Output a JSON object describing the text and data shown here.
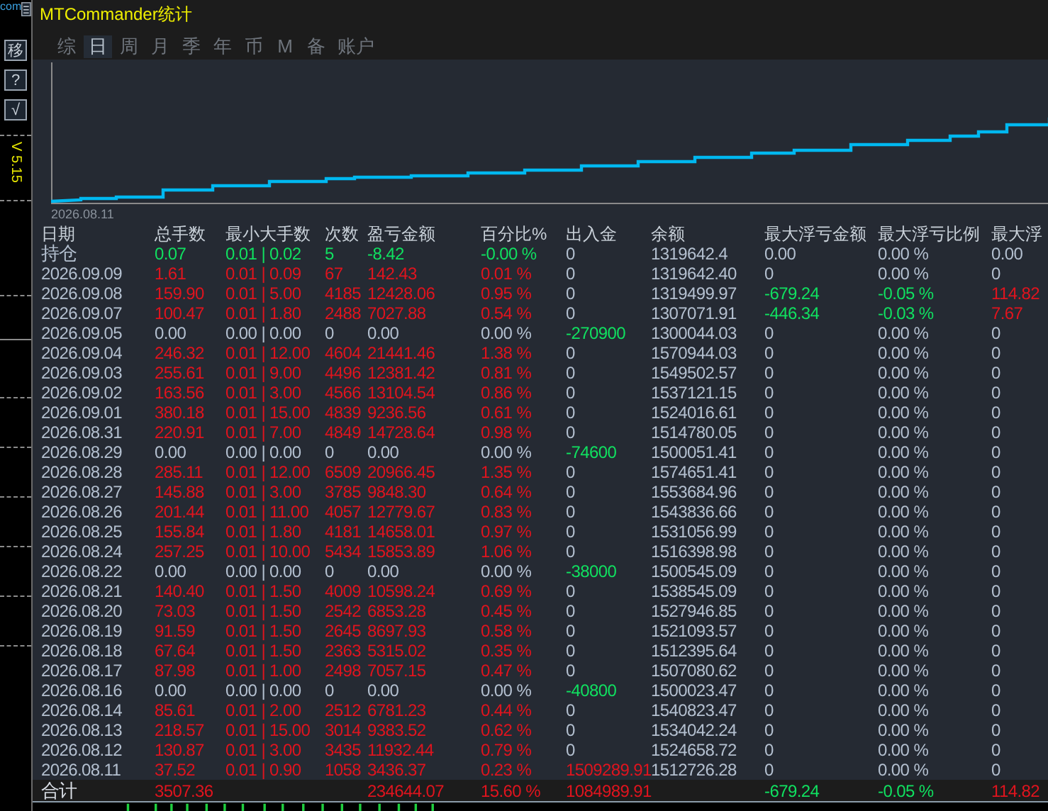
{
  "side_toolbar": {
    "site_text": "com",
    "buttons": [
      "移",
      "?",
      "√"
    ],
    "version": "V 5.15"
  },
  "window": {
    "title": "MTCommander统计"
  },
  "tabs": [
    {
      "label": "综",
      "selected": false
    },
    {
      "label": "日",
      "selected": true
    },
    {
      "label": "周",
      "selected": false
    },
    {
      "label": "月",
      "selected": false
    },
    {
      "label": "季",
      "selected": false
    },
    {
      "label": "年",
      "selected": false
    },
    {
      "label": "币",
      "selected": false
    },
    {
      "label": "M",
      "selected": false
    },
    {
      "label": "备",
      "selected": false
    },
    {
      "label": "账户",
      "selected": false
    }
  ],
  "chart": {
    "start_label": "2026.08.11"
  },
  "table": {
    "columns": [
      "日期",
      "总手数",
      "最小大手数",
      "次数",
      "盈亏金额",
      "百分比%",
      "出入金",
      "余额",
      "最大浮亏金额",
      "最大浮亏比例",
      "最大浮"
    ],
    "rows": [
      [
        {
          "text": "持仓",
          "color": "#b4c0d0"
        },
        {
          "text": "0.07",
          "color": "#10e060"
        },
        {
          "text": "0.01 | 0.02",
          "color": "#10e060"
        },
        {
          "text": "5",
          "color": "#10e060"
        },
        {
          "text": "-8.42",
          "color": "#10e060"
        },
        {
          "text": "-0.00 %",
          "color": "#10e060"
        },
        {
          "text": "0",
          "color": "#b4c0d0"
        },
        {
          "text": "1319642.4",
          "color": "#b4c0d0"
        },
        {
          "text": "0.00",
          "color": "#b4c0d0"
        },
        {
          "text": "0.00 %",
          "color": "#b4c0d0"
        },
        {
          "text": "0.00",
          "color": "#b4c0d0"
        }
      ],
      [
        {
          "text": "2026.09.09",
          "color": "#b4c0d0"
        },
        {
          "text": "1.61",
          "color": "#e0141e"
        },
        {
          "text": "0.01 | 0.09",
          "color": "#e0141e"
        },
        {
          "text": "67",
          "color": "#e0141e"
        },
        {
          "text": "142.43",
          "color": "#e0141e"
        },
        {
          "text": "0.01 %",
          "color": "#e0141e"
        },
        {
          "text": "0",
          "color": "#b4c0d0"
        },
        {
          "text": "1319642.40",
          "color": "#b4c0d0"
        },
        {
          "text": "0",
          "color": "#b4c0d0"
        },
        {
          "text": "0.00 %",
          "color": "#b4c0d0"
        },
        {
          "text": "0",
          "color": "#b4c0d0"
        }
      ],
      [
        {
          "text": "2026.09.08",
          "color": "#b4c0d0"
        },
        {
          "text": "159.90",
          "color": "#e0141e"
        },
        {
          "text": "0.01 | 5.00",
          "color": "#e0141e"
        },
        {
          "text": "4185",
          "color": "#e0141e"
        },
        {
          "text": "12428.06",
          "color": "#e0141e"
        },
        {
          "text": "0.95 %",
          "color": "#e0141e"
        },
        {
          "text": "0",
          "color": "#b4c0d0"
        },
        {
          "text": "1319499.97",
          "color": "#b4c0d0"
        },
        {
          "text": "-679.24",
          "color": "#10e060"
        },
        {
          "text": "-0.05 %",
          "color": "#10e060"
        },
        {
          "text": "114.82",
          "color": "#e0141e"
        }
      ],
      [
        {
          "text": "2026.09.07",
          "color": "#b4c0d0"
        },
        {
          "text": "100.47",
          "color": "#e0141e"
        },
        {
          "text": "0.01 | 1.80",
          "color": "#e0141e"
        },
        {
          "text": "2488",
          "color": "#e0141e"
        },
        {
          "text": "7027.88",
          "color": "#e0141e"
        },
        {
          "text": "0.54 %",
          "color": "#e0141e"
        },
        {
          "text": "0",
          "color": "#b4c0d0"
        },
        {
          "text": "1307071.91",
          "color": "#b4c0d0"
        },
        {
          "text": "-446.34",
          "color": "#10e060"
        },
        {
          "text": "-0.03 %",
          "color": "#10e060"
        },
        {
          "text": "7.67",
          "color": "#e0141e"
        }
      ],
      [
        {
          "text": "2026.09.05",
          "color": "#b4c0d0"
        },
        {
          "text": "0.00",
          "color": "#b4c0d0"
        },
        {
          "text": "0.00 | 0.00",
          "color": "#b4c0d0"
        },
        {
          "text": "0",
          "color": "#b4c0d0"
        },
        {
          "text": "0.00",
          "color": "#b4c0d0"
        },
        {
          "text": "0.00 %",
          "color": "#b4c0d0"
        },
        {
          "text": "-270900",
          "color": "#10e060"
        },
        {
          "text": "1300044.03",
          "color": "#b4c0d0"
        },
        {
          "text": "0",
          "color": "#b4c0d0"
        },
        {
          "text": "0.00 %",
          "color": "#b4c0d0"
        },
        {
          "text": "0",
          "color": "#b4c0d0"
        }
      ],
      [
        {
          "text": "2026.09.04",
          "color": "#b4c0d0"
        },
        {
          "text": "246.32",
          "color": "#e0141e"
        },
        {
          "text": "0.01 | 12.00",
          "color": "#e0141e"
        },
        {
          "text": "4604",
          "color": "#e0141e"
        },
        {
          "text": "21441.46",
          "color": "#e0141e"
        },
        {
          "text": "1.38 %",
          "color": "#e0141e"
        },
        {
          "text": "0",
          "color": "#b4c0d0"
        },
        {
          "text": "1570944.03",
          "color": "#b4c0d0"
        },
        {
          "text": "0",
          "color": "#b4c0d0"
        },
        {
          "text": "0.00 %",
          "color": "#b4c0d0"
        },
        {
          "text": "0",
          "color": "#b4c0d0"
        }
      ],
      [
        {
          "text": "2026.09.03",
          "color": "#b4c0d0"
        },
        {
          "text": "255.61",
          "color": "#e0141e"
        },
        {
          "text": "0.01 | 9.00",
          "color": "#e0141e"
        },
        {
          "text": "4496",
          "color": "#e0141e"
        },
        {
          "text": "12381.42",
          "color": "#e0141e"
        },
        {
          "text": "0.81 %",
          "color": "#e0141e"
        },
        {
          "text": "0",
          "color": "#b4c0d0"
        },
        {
          "text": "1549502.57",
          "color": "#b4c0d0"
        },
        {
          "text": "0",
          "color": "#b4c0d0"
        },
        {
          "text": "0.00 %",
          "color": "#b4c0d0"
        },
        {
          "text": "0",
          "color": "#b4c0d0"
        }
      ],
      [
        {
          "text": "2026.09.02",
          "color": "#b4c0d0"
        },
        {
          "text": "163.56",
          "color": "#e0141e"
        },
        {
          "text": "0.01 | 3.00",
          "color": "#e0141e"
        },
        {
          "text": "4566",
          "color": "#e0141e"
        },
        {
          "text": "13104.54",
          "color": "#e0141e"
        },
        {
          "text": "0.86 %",
          "color": "#e0141e"
        },
        {
          "text": "0",
          "color": "#b4c0d0"
        },
        {
          "text": "1537121.15",
          "color": "#b4c0d0"
        },
        {
          "text": "0",
          "color": "#b4c0d0"
        },
        {
          "text": "0.00 %",
          "color": "#b4c0d0"
        },
        {
          "text": "0",
          "color": "#b4c0d0"
        }
      ],
      [
        {
          "text": "2026.09.01",
          "color": "#b4c0d0"
        },
        {
          "text": "380.18",
          "color": "#e0141e"
        },
        {
          "text": "0.01 | 15.00",
          "color": "#e0141e"
        },
        {
          "text": "4839",
          "color": "#e0141e"
        },
        {
          "text": "9236.56",
          "color": "#e0141e"
        },
        {
          "text": "0.61 %",
          "color": "#e0141e"
        },
        {
          "text": "0",
          "color": "#b4c0d0"
        },
        {
          "text": "1524016.61",
          "color": "#b4c0d0"
        },
        {
          "text": "0",
          "color": "#b4c0d0"
        },
        {
          "text": "0.00 %",
          "color": "#b4c0d0"
        },
        {
          "text": "0",
          "color": "#b4c0d0"
        }
      ],
      [
        {
          "text": "2026.08.31",
          "color": "#b4c0d0"
        },
        {
          "text": "220.91",
          "color": "#e0141e"
        },
        {
          "text": "0.01 | 7.00",
          "color": "#e0141e"
        },
        {
          "text": "4849",
          "color": "#e0141e"
        },
        {
          "text": "14728.64",
          "color": "#e0141e"
        },
        {
          "text": "0.98 %",
          "color": "#e0141e"
        },
        {
          "text": "0",
          "color": "#b4c0d0"
        },
        {
          "text": "1514780.05",
          "color": "#b4c0d0"
        },
        {
          "text": "0",
          "color": "#b4c0d0"
        },
        {
          "text": "0.00 %",
          "color": "#b4c0d0"
        },
        {
          "text": "0",
          "color": "#b4c0d0"
        }
      ],
      [
        {
          "text": "2026.08.29",
          "color": "#b4c0d0"
        },
        {
          "text": "0.00",
          "color": "#b4c0d0"
        },
        {
          "text": "0.00 | 0.00",
          "color": "#b4c0d0"
        },
        {
          "text": "0",
          "color": "#b4c0d0"
        },
        {
          "text": "0.00",
          "color": "#b4c0d0"
        },
        {
          "text": "0.00 %",
          "color": "#b4c0d0"
        },
        {
          "text": "-74600",
          "color": "#10e060"
        },
        {
          "text": "1500051.41",
          "color": "#b4c0d0"
        },
        {
          "text": "0",
          "color": "#b4c0d0"
        },
        {
          "text": "0.00 %",
          "color": "#b4c0d0"
        },
        {
          "text": "0",
          "color": "#b4c0d0"
        }
      ],
      [
        {
          "text": "2026.08.28",
          "color": "#b4c0d0"
        },
        {
          "text": "285.11",
          "color": "#e0141e"
        },
        {
          "text": "0.01 | 12.00",
          "color": "#e0141e"
        },
        {
          "text": "6509",
          "color": "#e0141e"
        },
        {
          "text": "20966.45",
          "color": "#e0141e"
        },
        {
          "text": "1.35 %",
          "color": "#e0141e"
        },
        {
          "text": "0",
          "color": "#b4c0d0"
        },
        {
          "text": "1574651.41",
          "color": "#b4c0d0"
        },
        {
          "text": "0",
          "color": "#b4c0d0"
        },
        {
          "text": "0.00 %",
          "color": "#b4c0d0"
        },
        {
          "text": "0",
          "color": "#b4c0d0"
        }
      ],
      [
        {
          "text": "2026.08.27",
          "color": "#b4c0d0"
        },
        {
          "text": "145.88",
          "color": "#e0141e"
        },
        {
          "text": "0.01 | 3.00",
          "color": "#e0141e"
        },
        {
          "text": "3785",
          "color": "#e0141e"
        },
        {
          "text": "9848.30",
          "color": "#e0141e"
        },
        {
          "text": "0.64 %",
          "color": "#e0141e"
        },
        {
          "text": "0",
          "color": "#b4c0d0"
        },
        {
          "text": "1553684.96",
          "color": "#b4c0d0"
        },
        {
          "text": "0",
          "color": "#b4c0d0"
        },
        {
          "text": "0.00 %",
          "color": "#b4c0d0"
        },
        {
          "text": "0",
          "color": "#b4c0d0"
        }
      ],
      [
        {
          "text": "2026.08.26",
          "color": "#b4c0d0"
        },
        {
          "text": "201.44",
          "color": "#e0141e"
        },
        {
          "text": "0.01 | 11.00",
          "color": "#e0141e"
        },
        {
          "text": "4057",
          "color": "#e0141e"
        },
        {
          "text": "12779.67",
          "color": "#e0141e"
        },
        {
          "text": "0.83 %",
          "color": "#e0141e"
        },
        {
          "text": "0",
          "color": "#b4c0d0"
        },
        {
          "text": "1543836.66",
          "color": "#b4c0d0"
        },
        {
          "text": "0",
          "color": "#b4c0d0"
        },
        {
          "text": "0.00 %",
          "color": "#b4c0d0"
        },
        {
          "text": "0",
          "color": "#b4c0d0"
        }
      ],
      [
        {
          "text": "2026.08.25",
          "color": "#b4c0d0"
        },
        {
          "text": "155.84",
          "color": "#e0141e"
        },
        {
          "text": "0.01 | 1.80",
          "color": "#e0141e"
        },
        {
          "text": "4181",
          "color": "#e0141e"
        },
        {
          "text": "14658.01",
          "color": "#e0141e"
        },
        {
          "text": "0.97 %",
          "color": "#e0141e"
        },
        {
          "text": "0",
          "color": "#b4c0d0"
        },
        {
          "text": "1531056.99",
          "color": "#b4c0d0"
        },
        {
          "text": "0",
          "color": "#b4c0d0"
        },
        {
          "text": "0.00 %",
          "color": "#b4c0d0"
        },
        {
          "text": "0",
          "color": "#b4c0d0"
        }
      ],
      [
        {
          "text": "2026.08.24",
          "color": "#b4c0d0"
        },
        {
          "text": "257.25",
          "color": "#e0141e"
        },
        {
          "text": "0.01 | 10.00",
          "color": "#e0141e"
        },
        {
          "text": "5434",
          "color": "#e0141e"
        },
        {
          "text": "15853.89",
          "color": "#e0141e"
        },
        {
          "text": "1.06 %",
          "color": "#e0141e"
        },
        {
          "text": "0",
          "color": "#b4c0d0"
        },
        {
          "text": "1516398.98",
          "color": "#b4c0d0"
        },
        {
          "text": "0",
          "color": "#b4c0d0"
        },
        {
          "text": "0.00 %",
          "color": "#b4c0d0"
        },
        {
          "text": "0",
          "color": "#b4c0d0"
        }
      ],
      [
        {
          "text": "2026.08.22",
          "color": "#b4c0d0"
        },
        {
          "text": "0.00",
          "color": "#b4c0d0"
        },
        {
          "text": "0.00 | 0.00",
          "color": "#b4c0d0"
        },
        {
          "text": "0",
          "color": "#b4c0d0"
        },
        {
          "text": "0.00",
          "color": "#b4c0d0"
        },
        {
          "text": "0.00 %",
          "color": "#b4c0d0"
        },
        {
          "text": "-38000",
          "color": "#10e060"
        },
        {
          "text": "1500545.09",
          "color": "#b4c0d0"
        },
        {
          "text": "0",
          "color": "#b4c0d0"
        },
        {
          "text": "0.00 %",
          "color": "#b4c0d0"
        },
        {
          "text": "0",
          "color": "#b4c0d0"
        }
      ],
      [
        {
          "text": "2026.08.21",
          "color": "#b4c0d0"
        },
        {
          "text": "140.40",
          "color": "#e0141e"
        },
        {
          "text": "0.01 | 1.50",
          "color": "#e0141e"
        },
        {
          "text": "4009",
          "color": "#e0141e"
        },
        {
          "text": "10598.24",
          "color": "#e0141e"
        },
        {
          "text": "0.69 %",
          "color": "#e0141e"
        },
        {
          "text": "0",
          "color": "#b4c0d0"
        },
        {
          "text": "1538545.09",
          "color": "#b4c0d0"
        },
        {
          "text": "0",
          "color": "#b4c0d0"
        },
        {
          "text": "0.00 %",
          "color": "#b4c0d0"
        },
        {
          "text": "0",
          "color": "#b4c0d0"
        }
      ],
      [
        {
          "text": "2026.08.20",
          "color": "#b4c0d0"
        },
        {
          "text": "73.03",
          "color": "#e0141e"
        },
        {
          "text": "0.01 | 1.50",
          "color": "#e0141e"
        },
        {
          "text": "2542",
          "color": "#e0141e"
        },
        {
          "text": "6853.28",
          "color": "#e0141e"
        },
        {
          "text": "0.45 %",
          "color": "#e0141e"
        },
        {
          "text": "0",
          "color": "#b4c0d0"
        },
        {
          "text": "1527946.85",
          "color": "#b4c0d0"
        },
        {
          "text": "0",
          "color": "#b4c0d0"
        },
        {
          "text": "0.00 %",
          "color": "#b4c0d0"
        },
        {
          "text": "0",
          "color": "#b4c0d0"
        }
      ],
      [
        {
          "text": "2026.08.19",
          "color": "#b4c0d0"
        },
        {
          "text": "91.59",
          "color": "#e0141e"
        },
        {
          "text": "0.01 | 1.50",
          "color": "#e0141e"
        },
        {
          "text": "2645",
          "color": "#e0141e"
        },
        {
          "text": "8697.93",
          "color": "#e0141e"
        },
        {
          "text": "0.58 %",
          "color": "#e0141e"
        },
        {
          "text": "0",
          "color": "#b4c0d0"
        },
        {
          "text": "1521093.57",
          "color": "#b4c0d0"
        },
        {
          "text": "0",
          "color": "#b4c0d0"
        },
        {
          "text": "0.00 %",
          "color": "#b4c0d0"
        },
        {
          "text": "0",
          "color": "#b4c0d0"
        }
      ],
      [
        {
          "text": "2026.08.18",
          "color": "#b4c0d0"
        },
        {
          "text": "67.64",
          "color": "#e0141e"
        },
        {
          "text": "0.01 | 1.50",
          "color": "#e0141e"
        },
        {
          "text": "2363",
          "color": "#e0141e"
        },
        {
          "text": "5315.02",
          "color": "#e0141e"
        },
        {
          "text": "0.35 %",
          "color": "#e0141e"
        },
        {
          "text": "0",
          "color": "#b4c0d0"
        },
        {
          "text": "1512395.64",
          "color": "#b4c0d0"
        },
        {
          "text": "0",
          "color": "#b4c0d0"
        },
        {
          "text": "0.00 %",
          "color": "#b4c0d0"
        },
        {
          "text": "0",
          "color": "#b4c0d0"
        }
      ],
      [
        {
          "text": "2026.08.17",
          "color": "#b4c0d0"
        },
        {
          "text": "87.98",
          "color": "#e0141e"
        },
        {
          "text": "0.01 | 1.00",
          "color": "#e0141e"
        },
        {
          "text": "2498",
          "color": "#e0141e"
        },
        {
          "text": "7057.15",
          "color": "#e0141e"
        },
        {
          "text": "0.47 %",
          "color": "#e0141e"
        },
        {
          "text": "0",
          "color": "#b4c0d0"
        },
        {
          "text": "1507080.62",
          "color": "#b4c0d0"
        },
        {
          "text": "0",
          "color": "#b4c0d0"
        },
        {
          "text": "0.00 %",
          "color": "#b4c0d0"
        },
        {
          "text": "0",
          "color": "#b4c0d0"
        }
      ],
      [
        {
          "text": "2026.08.16",
          "color": "#b4c0d0"
        },
        {
          "text": "0.00",
          "color": "#b4c0d0"
        },
        {
          "text": "0.00 | 0.00",
          "color": "#b4c0d0"
        },
        {
          "text": "0",
          "color": "#b4c0d0"
        },
        {
          "text": "0.00",
          "color": "#b4c0d0"
        },
        {
          "text": "0.00 %",
          "color": "#b4c0d0"
        },
        {
          "text": "-40800",
          "color": "#10e060"
        },
        {
          "text": "1500023.47",
          "color": "#b4c0d0"
        },
        {
          "text": "0",
          "color": "#b4c0d0"
        },
        {
          "text": "0.00 %",
          "color": "#b4c0d0"
        },
        {
          "text": "0",
          "color": "#b4c0d0"
        }
      ],
      [
        {
          "text": "2026.08.14",
          "color": "#b4c0d0"
        },
        {
          "text": "85.61",
          "color": "#e0141e"
        },
        {
          "text": "0.01 | 2.00",
          "color": "#e0141e"
        },
        {
          "text": "2512",
          "color": "#e0141e"
        },
        {
          "text": "6781.23",
          "color": "#e0141e"
        },
        {
          "text": "0.44 %",
          "color": "#e0141e"
        },
        {
          "text": "0",
          "color": "#b4c0d0"
        },
        {
          "text": "1540823.47",
          "color": "#b4c0d0"
        },
        {
          "text": "0",
          "color": "#b4c0d0"
        },
        {
          "text": "0.00 %",
          "color": "#b4c0d0"
        },
        {
          "text": "0",
          "color": "#b4c0d0"
        }
      ],
      [
        {
          "text": "2026.08.13",
          "color": "#b4c0d0"
        },
        {
          "text": "218.57",
          "color": "#e0141e"
        },
        {
          "text": "0.01 | 15.00",
          "color": "#e0141e"
        },
        {
          "text": "3014",
          "color": "#e0141e"
        },
        {
          "text": "9383.52",
          "color": "#e0141e"
        },
        {
          "text": "0.62 %",
          "color": "#e0141e"
        },
        {
          "text": "0",
          "color": "#b4c0d0"
        },
        {
          "text": "1534042.24",
          "color": "#b4c0d0"
        },
        {
          "text": "0",
          "color": "#b4c0d0"
        },
        {
          "text": "0.00 %",
          "color": "#b4c0d0"
        },
        {
          "text": "0",
          "color": "#b4c0d0"
        }
      ],
      [
        {
          "text": "2026.08.12",
          "color": "#b4c0d0"
        },
        {
          "text": "130.87",
          "color": "#e0141e"
        },
        {
          "text": "0.01 | 3.00",
          "color": "#e0141e"
        },
        {
          "text": "3435",
          "color": "#e0141e"
        },
        {
          "text": "11932.44",
          "color": "#e0141e"
        },
        {
          "text": "0.79 %",
          "color": "#e0141e"
        },
        {
          "text": "0",
          "color": "#b4c0d0"
        },
        {
          "text": "1524658.72",
          "color": "#b4c0d0"
        },
        {
          "text": "0",
          "color": "#b4c0d0"
        },
        {
          "text": "0.00 %",
          "color": "#b4c0d0"
        },
        {
          "text": "0",
          "color": "#b4c0d0"
        }
      ],
      [
        {
          "text": "2026.08.11",
          "color": "#b4c0d0"
        },
        {
          "text": "37.52",
          "color": "#e0141e"
        },
        {
          "text": "0.01 | 0.90",
          "color": "#e0141e"
        },
        {
          "text": "1058",
          "color": "#e0141e"
        },
        {
          "text": "3436.37",
          "color": "#e0141e"
        },
        {
          "text": "0.23 %",
          "color": "#e0141e"
        },
        {
          "text": "1509289.91",
          "color": "#e0141e"
        },
        {
          "text": "1512726.28",
          "color": "#b4c0d0"
        },
        {
          "text": "0",
          "color": "#b4c0d0"
        },
        {
          "text": "0.00 %",
          "color": "#b4c0d0"
        },
        {
          "text": "0",
          "color": "#b4c0d0"
        }
      ]
    ],
    "total": {
      "label": {
        "text": "合计",
        "color": "#d8dde4"
      },
      "total_lots": {
        "text": "3507.36",
        "color": "#e0141e"
      },
      "profit": {
        "text": "234644.07",
        "color": "#e0141e"
      },
      "percent": {
        "text": "15.60 %",
        "color": "#e0141e"
      },
      "deposit": {
        "text": "1084989.91",
        "color": "#e0141e"
      },
      "max_float_loss": {
        "text": "-679.24",
        "color": "#10e060"
      },
      "max_float_ratio": {
        "text": "-0.05 %",
        "color": "#10e060"
      },
      "max_float_gain": {
        "text": "114.82",
        "color": "#e0141e"
      }
    }
  }
}
